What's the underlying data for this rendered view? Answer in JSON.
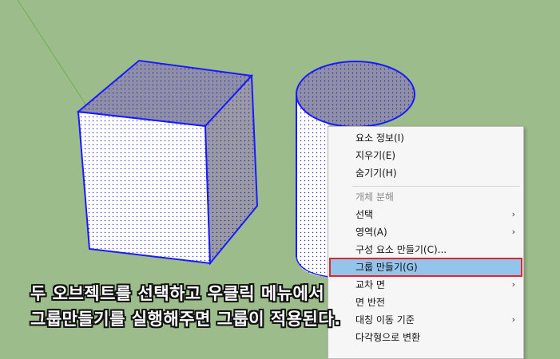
{
  "viewport": {
    "background": "#9cbc8c",
    "edge_color": "#1a1aff"
  },
  "context_menu": {
    "items": [
      {
        "label": "요소 정보(I)"
      },
      {
        "label": "지우기(E)"
      },
      {
        "label": "숨기기(H)"
      },
      {
        "label": "개체 분해",
        "disabled": true
      },
      {
        "label": "선택",
        "submenu": true
      },
      {
        "label": "영역(A)",
        "submenu": true
      },
      {
        "label": "구성 요소 만들기(C)..."
      },
      {
        "label": "그룹 만들기(G)",
        "highlighted": true
      },
      {
        "label": "교차 면",
        "submenu": true
      },
      {
        "label": "면 반전"
      },
      {
        "label": "대칭 이동 기준",
        "submenu": true
      },
      {
        "label": "다각형으로 변환"
      }
    ],
    "highlight_color": "#92c4ec",
    "highlight_border": "#e0262a"
  },
  "caption": {
    "line1": "두 오브젝트를 선택하고 우클릭 메뉴에서",
    "line2": "그룹만들기를 실행해주면 그룹이 적용된다."
  }
}
